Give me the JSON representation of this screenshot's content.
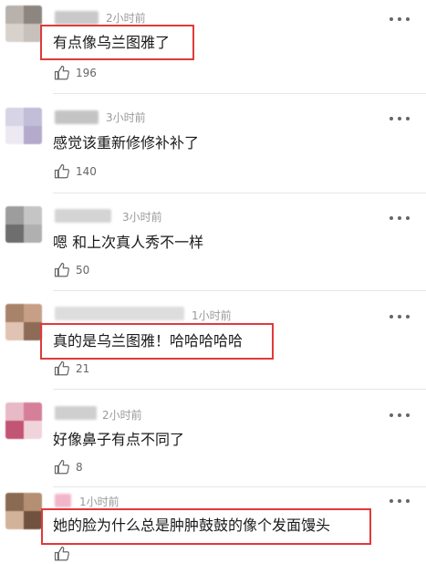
{
  "comments": [
    {
      "time": "2小时前",
      "text": "有点像乌兰图雅了",
      "likes": "196"
    },
    {
      "time": "3小时前",
      "text": "感觉该重新修修补补了",
      "likes": "140"
    },
    {
      "time": "3小时前",
      "text": "嗯 和上次真人秀不一样",
      "likes": "50"
    },
    {
      "time": "1小时前",
      "text": "真的是乌兰图雅！哈哈哈哈哈",
      "likes": "21"
    },
    {
      "time": "2小时前",
      "text": "好像鼻子有点不同了",
      "likes": "8"
    },
    {
      "time": "1小时前",
      "text": "她的脸为什么总是肿肿鼓鼓的像个发面馒头",
      "likes": ""
    }
  ],
  "colors": {
    "highlight": "#e03a3a",
    "text": "#1a1a1a",
    "meta": "#9a9a9a"
  },
  "icons": {
    "like": "thumbs-up-icon",
    "more": "more-dots-icon"
  }
}
